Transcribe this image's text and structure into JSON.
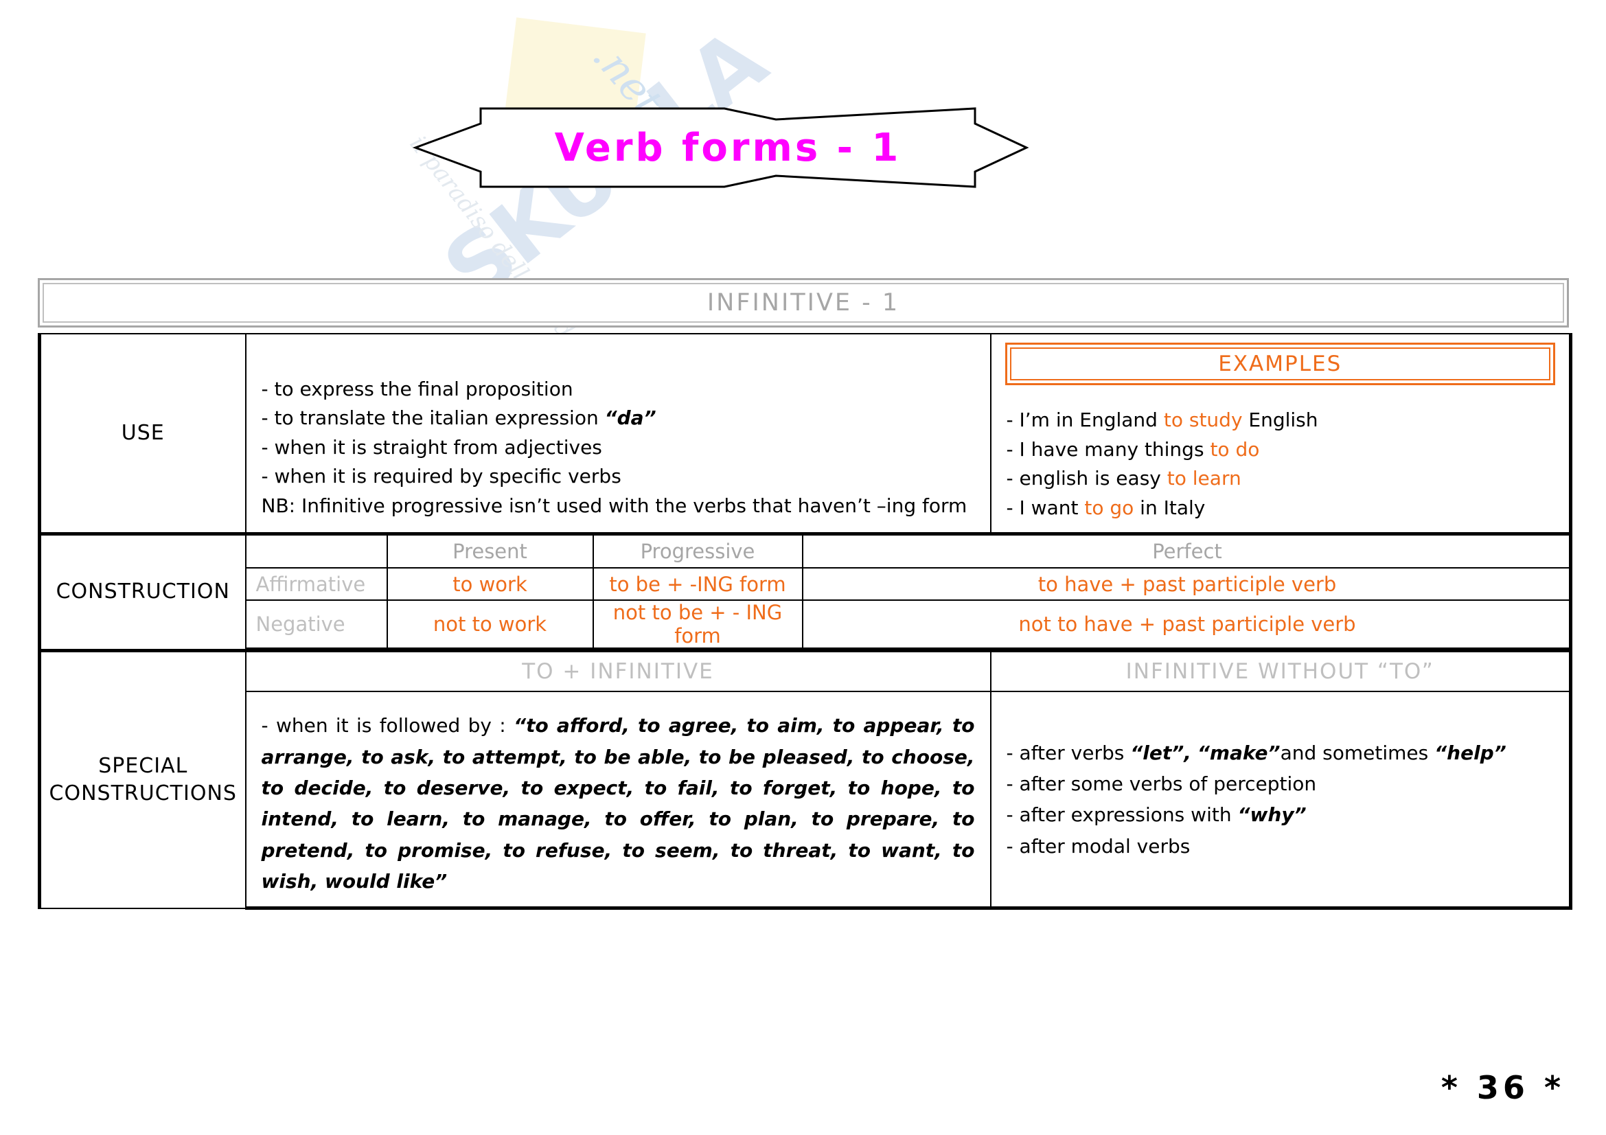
{
  "watermark": {
    "name": "SKUOLA",
    "tld": ".net",
    "tagline": "il paradiso dello studente"
  },
  "banner": {
    "title": "Verb forms - 1",
    "color": "#ff00ff"
  },
  "sheet": {
    "header": "INFINITIVE - 1",
    "header_color": "#a6a6a6",
    "examples_header": "EXAMPLES",
    "examples_color": "#ef6c1a"
  },
  "rows": {
    "use": {
      "label": "USE",
      "points": [
        {
          "prefix": "- to express the final proposition",
          "emphasis": "",
          "suffix": ""
        },
        {
          "prefix": "- to translate the italian expression ",
          "emphasis": "“da”",
          "suffix": ""
        },
        {
          "prefix": "- when it is straight from adjectives",
          "emphasis": "",
          "suffix": ""
        },
        {
          "prefix": "- when it is required by specific verbs",
          "emphasis": "",
          "suffix": ""
        }
      ],
      "note": "NB: Infinitive progressive isn’t used with the verbs that haven’t –ing form",
      "examples": [
        {
          "before": "- I’m in England ",
          "highlight": "to study",
          "after": " English"
        },
        {
          "before": "- I have many things ",
          "highlight": "to do",
          "after": ""
        },
        {
          "before": "- english is easy ",
          "highlight": "to learn",
          "after": ""
        },
        {
          "before": "- I want ",
          "highlight": "to go",
          "after": " in Italy"
        }
      ]
    },
    "construction": {
      "label": "CONSTRUCTION",
      "columns": [
        "Present",
        "Progressive",
        "Perfect"
      ],
      "row_headers": [
        "Affirmative",
        "Negative"
      ],
      "values": [
        [
          "to work",
          "to be + -ING form",
          "to have + past participle verb"
        ],
        [
          "not to work",
          "not to be + - ING form",
          "not to have + past participle verb"
        ]
      ],
      "value_color": "#ef6c1a",
      "header_color": "#a6a6a6"
    },
    "special": {
      "label_line1": "SPECIAL",
      "label_line2": "CONSTRUCTIONS",
      "left_header": "TO + INFINITIVE",
      "right_header": "INFINITIVE WITHOUT “TO”",
      "left_lead": "- when it is followed by : ",
      "left_verbs": "“to afford, to agree, to aim, to appear, to arrange, to ask, to attempt, to be able, to be pleased, to choose, to decide, to deserve, to expect, to fail, to forget, to hope, to intend, to learn, to manage, to offer, to plan, to prepare, to pretend, to promise, to refuse, to seem, to threat, to want, to wish, would like”",
      "right_points": [
        {
          "before": "- after verbs ",
          "em1": "“let”,",
          "mid": "  ",
          "em2": "“make”",
          "mid2": "and sometimes ",
          "em3": "“help”",
          "after": ""
        },
        {
          "before": "- after some verbs of perception",
          "em1": "",
          "mid": "",
          "em2": "",
          "mid2": "",
          "em3": "",
          "after": ""
        },
        {
          "before": "- after expressions with ",
          "em1": "“why”",
          "mid": "",
          "em2": "",
          "mid2": "",
          "em3": "",
          "after": ""
        },
        {
          "before": "- after modal verbs",
          "em1": "",
          "mid": "",
          "em2": "",
          "mid2": "",
          "em3": "",
          "after": ""
        }
      ]
    }
  },
  "footer": {
    "page_number": "* 36 *"
  }
}
